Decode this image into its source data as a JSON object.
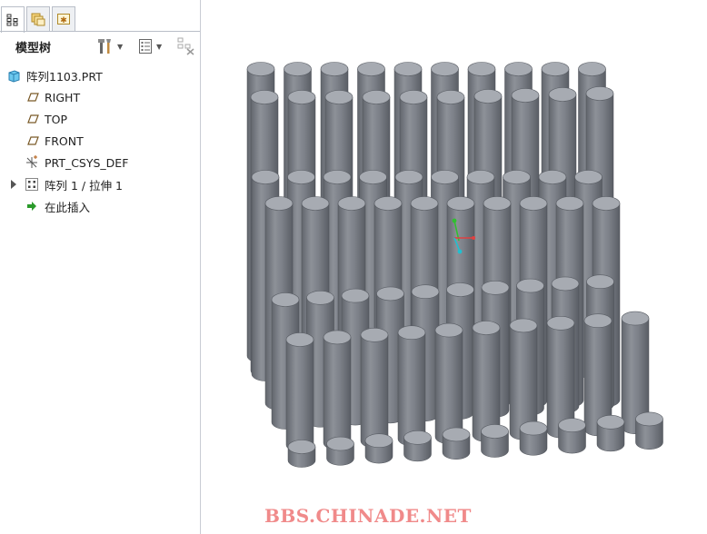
{
  "model_tree": {
    "title": "模型树",
    "items": [
      {
        "label": "阵列1103.PRT",
        "icon": "part-icon"
      },
      {
        "label": "RIGHT",
        "icon": "datum-plane-icon"
      },
      {
        "label": "TOP",
        "icon": "datum-plane-icon"
      },
      {
        "label": "FRONT",
        "icon": "datum-plane-icon"
      },
      {
        "label": "PRT_CSYS_DEF",
        "icon": "coordinate-system-icon"
      },
      {
        "label": "阵列 1 / 拉伸 1",
        "icon": "pattern-icon"
      },
      {
        "label": "在此插入",
        "icon": "insert-here-arrow-icon"
      }
    ]
  },
  "tabs": [
    {
      "name": "model-tree-tab",
      "icon": "model-tree-icon",
      "active": true
    },
    {
      "name": "folder-browser-tab",
      "icon": "folder-browser-icon",
      "active": false
    },
    {
      "name": "favorites-tab",
      "icon": "favorites-icon",
      "active": false
    }
  ],
  "toolbar_icons": [
    "settings-tools-icon",
    "show-list-icon",
    "filter-icon"
  ],
  "watermark": "BBS.CHINADE.NET",
  "colors": {
    "cylinder_body": "#7e838b",
    "cylinder_top": "#a7abb2",
    "watermark": "#f08a8a",
    "csys_x": "#e04040",
    "csys_y": "#30c030",
    "csys_z": "#20c0d0"
  }
}
